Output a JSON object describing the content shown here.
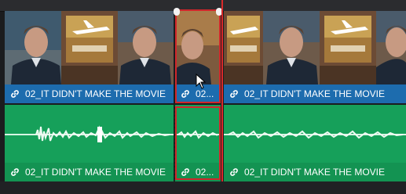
{
  "timeline": {
    "clips": {
      "video_left": {
        "label": "02_IT DIDN'T MAKE THE MOVIE"
      },
      "video_middle": {
        "label": "02..."
      },
      "video_right": {
        "label": "02_IT DIDN'T MAKE THE MOVIE"
      },
      "audio_left": {
        "label": "02_IT DIDN'T MAKE THE MOVIE"
      },
      "audio_middle": {
        "label": "02..."
      },
      "audio_right": {
        "label": "02_IT DIDN'T MAKE THE MOVIE"
      }
    },
    "colors": {
      "video_clip": "#1d6cae",
      "audio_clip": "#16a05a",
      "selection": "#d1262b",
      "playhead": "#d82a2a"
    },
    "icons": [
      "link-icon",
      "pointer-cursor-icon",
      "trim-handle-icon"
    ]
  }
}
